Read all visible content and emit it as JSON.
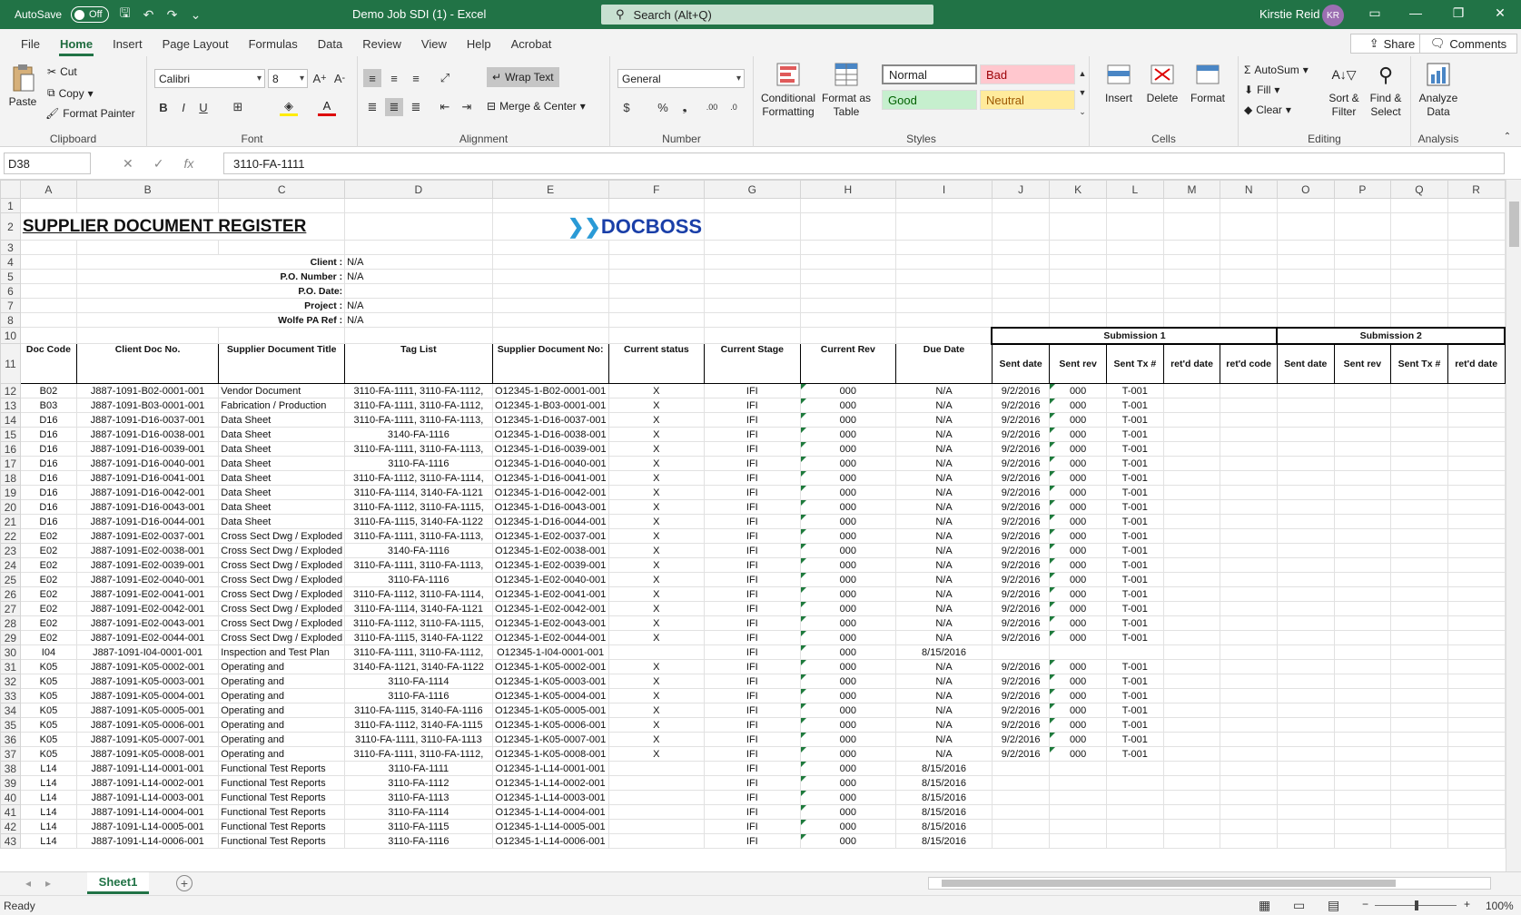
{
  "titlebar": {
    "autosave_label": "AutoSave",
    "autosave_state": "Off",
    "doc_title": "Demo Job SDI (1)  -  Excel",
    "search_placeholder": "Search (Alt+Q)",
    "user_name": "Kirstie Reid",
    "user_initials": "KR"
  },
  "menu": {
    "tabs": [
      "File",
      "Home",
      "Insert",
      "Page Layout",
      "Formulas",
      "Data",
      "Review",
      "View",
      "Help",
      "Acrobat"
    ],
    "share": "Share",
    "comments": "Comments"
  },
  "ribbon": {
    "clipboard": {
      "paste": "Paste",
      "cut": "Cut",
      "copy": "Copy",
      "format_painter": "Format Painter",
      "label": "Clipboard"
    },
    "font": {
      "name": "Calibri",
      "size": "8",
      "label": "Font"
    },
    "alignment": {
      "wrap": "Wrap Text",
      "merge": "Merge & Center",
      "label": "Alignment"
    },
    "number": {
      "format": "General",
      "label": "Number"
    },
    "styles": {
      "conditional": "Conditional",
      "conditional2": "Formatting",
      "format_as": "Format as",
      "format_as2": "Table",
      "normal": "Normal",
      "bad": "Bad",
      "good": "Good",
      "neutral": "Neutral",
      "label": "Styles"
    },
    "cells": {
      "insert": "Insert",
      "delete": "Delete",
      "format": "Format",
      "label": "Cells"
    },
    "editing": {
      "autosum": "AutoSum",
      "fill": "Fill",
      "clear": "Clear",
      "sort": "Sort &",
      "sort2": "Filter",
      "find": "Find &",
      "find2": "Select",
      "label": "Editing"
    },
    "analysis": {
      "analyze": "Analyze",
      "analyze2": "Data",
      "label": "Analysis"
    }
  },
  "formula": {
    "cell_ref": "D38",
    "content": "3110-FA-1111"
  },
  "columns": [
    "A",
    "B",
    "C",
    "D",
    "E",
    "F",
    "G",
    "H",
    "I",
    "J",
    "K",
    "L",
    "M",
    "N",
    "O",
    "P",
    "Q",
    "R"
  ],
  "sheet": {
    "title": "SUPPLIER DOCUMENT REGISTER",
    "logo": "DOCBOSS",
    "meta": [
      {
        "row": "4",
        "label": "Client :",
        "value": "N/A"
      },
      {
        "row": "5",
        "label": "P.O. Number :",
        "value": "N/A"
      },
      {
        "row": "6",
        "label": "P.O. Date:",
        "value": ""
      },
      {
        "row": "7",
        "label": "Project :",
        "value": "N/A"
      },
      {
        "row": "8",
        "label": "Wolfe PA Ref :",
        "value": "N/A"
      }
    ],
    "submission1": "Submission 1",
    "submission2": "Submission 2",
    "headers": [
      "Doc Code",
      "Client Doc No.",
      "Supplier Document Title",
      "Tag List",
      "Supplier Document No:",
      "Current status",
      "Current Stage",
      "Current Rev",
      "Due Date",
      "Sent date",
      "Sent rev",
      "Sent Tx #",
      "ret'd date",
      "ret'd code",
      "Sent date",
      "Sent rev",
      "Sent Tx #",
      "ret'd date"
    ],
    "rows": [
      [
        "12",
        "B02",
        "J887-1091-B02-0001-001",
        "Vendor Document",
        "3110-FA-1111, 3110-FA-1112,",
        "O12345-1-B02-0001-001",
        "X",
        "IFI",
        "000",
        "N/A",
        "9/2/2016",
        "000",
        "T-001"
      ],
      [
        "13",
        "B03",
        "J887-1091-B03-0001-001",
        "Fabrication / Production",
        "3110-FA-1111, 3110-FA-1112,",
        "O12345-1-B03-0001-001",
        "X",
        "IFI",
        "000",
        "N/A",
        "9/2/2016",
        "000",
        "T-001"
      ],
      [
        "14",
        "D16",
        "J887-1091-D16-0037-001",
        "Data Sheet",
        "3110-FA-1111, 3110-FA-1113,",
        "O12345-1-D16-0037-001",
        "X",
        "IFI",
        "000",
        "N/A",
        "9/2/2016",
        "000",
        "T-001"
      ],
      [
        "15",
        "D16",
        "J887-1091-D16-0038-001",
        "Data Sheet",
        "3140-FA-1116",
        "O12345-1-D16-0038-001",
        "X",
        "IFI",
        "000",
        "N/A",
        "9/2/2016",
        "000",
        "T-001"
      ],
      [
        "16",
        "D16",
        "J887-1091-D16-0039-001",
        "Data Sheet",
        "3110-FA-1111, 3110-FA-1113,",
        "O12345-1-D16-0039-001",
        "X",
        "IFI",
        "000",
        "N/A",
        "9/2/2016",
        "000",
        "T-001"
      ],
      [
        "17",
        "D16",
        "J887-1091-D16-0040-001",
        "Data Sheet",
        "3110-FA-1116",
        "O12345-1-D16-0040-001",
        "X",
        "IFI",
        "000",
        "N/A",
        "9/2/2016",
        "000",
        "T-001"
      ],
      [
        "18",
        "D16",
        "J887-1091-D16-0041-001",
        "Data Sheet",
        "3110-FA-1112, 3110-FA-1114,",
        "O12345-1-D16-0041-001",
        "X",
        "IFI",
        "000",
        "N/A",
        "9/2/2016",
        "000",
        "T-001"
      ],
      [
        "19",
        "D16",
        "J887-1091-D16-0042-001",
        "Data Sheet",
        "3110-FA-1114, 3140-FA-1121",
        "O12345-1-D16-0042-001",
        "X",
        "IFI",
        "000",
        "N/A",
        "9/2/2016",
        "000",
        "T-001"
      ],
      [
        "20",
        "D16",
        "J887-1091-D16-0043-001",
        "Data Sheet",
        "3110-FA-1112, 3110-FA-1115,",
        "O12345-1-D16-0043-001",
        "X",
        "IFI",
        "000",
        "N/A",
        "9/2/2016",
        "000",
        "T-001"
      ],
      [
        "21",
        "D16",
        "J887-1091-D16-0044-001",
        "Data Sheet",
        "3110-FA-1115, 3140-FA-1122",
        "O12345-1-D16-0044-001",
        "X",
        "IFI",
        "000",
        "N/A",
        "9/2/2016",
        "000",
        "T-001"
      ],
      [
        "22",
        "E02",
        "J887-1091-E02-0037-001",
        "Cross Sect Dwg / Exploded",
        "3110-FA-1111, 3110-FA-1113,",
        "O12345-1-E02-0037-001",
        "X",
        "IFI",
        "000",
        "N/A",
        "9/2/2016",
        "000",
        "T-001"
      ],
      [
        "23",
        "E02",
        "J887-1091-E02-0038-001",
        "Cross Sect Dwg / Exploded",
        "3140-FA-1116",
        "O12345-1-E02-0038-001",
        "X",
        "IFI",
        "000",
        "N/A",
        "9/2/2016",
        "000",
        "T-001"
      ],
      [
        "24",
        "E02",
        "J887-1091-E02-0039-001",
        "Cross Sect Dwg / Exploded",
        "3110-FA-1111, 3110-FA-1113,",
        "O12345-1-E02-0039-001",
        "X",
        "IFI",
        "000",
        "N/A",
        "9/2/2016",
        "000",
        "T-001"
      ],
      [
        "25",
        "E02",
        "J887-1091-E02-0040-001",
        "Cross Sect Dwg / Exploded",
        "3110-FA-1116",
        "O12345-1-E02-0040-001",
        "X",
        "IFI",
        "000",
        "N/A",
        "9/2/2016",
        "000",
        "T-001"
      ],
      [
        "26",
        "E02",
        "J887-1091-E02-0041-001",
        "Cross Sect Dwg / Exploded",
        "3110-FA-1112, 3110-FA-1114,",
        "O12345-1-E02-0041-001",
        "X",
        "IFI",
        "000",
        "N/A",
        "9/2/2016",
        "000",
        "T-001"
      ],
      [
        "27",
        "E02",
        "J887-1091-E02-0042-001",
        "Cross Sect Dwg / Exploded",
        "3110-FA-1114, 3140-FA-1121",
        "O12345-1-E02-0042-001",
        "X",
        "IFI",
        "000",
        "N/A",
        "9/2/2016",
        "000",
        "T-001"
      ],
      [
        "28",
        "E02",
        "J887-1091-E02-0043-001",
        "Cross Sect Dwg / Exploded",
        "3110-FA-1112, 3110-FA-1115,",
        "O12345-1-E02-0043-001",
        "X",
        "IFI",
        "000",
        "N/A",
        "9/2/2016",
        "000",
        "T-001"
      ],
      [
        "29",
        "E02",
        "J887-1091-E02-0044-001",
        "Cross Sect Dwg / Exploded",
        "3110-FA-1115, 3140-FA-1122",
        "O12345-1-E02-0044-001",
        "X",
        "IFI",
        "000",
        "N/A",
        "9/2/2016",
        "000",
        "T-001"
      ],
      [
        "30",
        "I04",
        "J887-1091-I04-0001-001",
        "Inspection and Test Plan",
        "3110-FA-1111, 3110-FA-1112,",
        "O12345-1-I04-0001-001",
        "",
        "IFI",
        "000",
        "8/15/2016",
        "",
        "",
        ""
      ],
      [
        "31",
        "K05",
        "J887-1091-K05-0002-001",
        "Operating and",
        "3140-FA-1121, 3140-FA-1122",
        "O12345-1-K05-0002-001",
        "X",
        "IFI",
        "000",
        "N/A",
        "9/2/2016",
        "000",
        "T-001"
      ],
      [
        "32",
        "K05",
        "J887-1091-K05-0003-001",
        "Operating and",
        "3110-FA-1114",
        "O12345-1-K05-0003-001",
        "X",
        "IFI",
        "000",
        "N/A",
        "9/2/2016",
        "000",
        "T-001"
      ],
      [
        "33",
        "K05",
        "J887-1091-K05-0004-001",
        "Operating and",
        "3110-FA-1116",
        "O12345-1-K05-0004-001",
        "X",
        "IFI",
        "000",
        "N/A",
        "9/2/2016",
        "000",
        "T-001"
      ],
      [
        "34",
        "K05",
        "J887-1091-K05-0005-001",
        "Operating and",
        "3110-FA-1115, 3140-FA-1116",
        "O12345-1-K05-0005-001",
        "X",
        "IFI",
        "000",
        "N/A",
        "9/2/2016",
        "000",
        "T-001"
      ],
      [
        "35",
        "K05",
        "J887-1091-K05-0006-001",
        "Operating and",
        "3110-FA-1112, 3140-FA-1115",
        "O12345-1-K05-0006-001",
        "X",
        "IFI",
        "000",
        "N/A",
        "9/2/2016",
        "000",
        "T-001"
      ],
      [
        "36",
        "K05",
        "J887-1091-K05-0007-001",
        "Operating and",
        "3110-FA-1111, 3110-FA-1113",
        "O12345-1-K05-0007-001",
        "X",
        "IFI",
        "000",
        "N/A",
        "9/2/2016",
        "000",
        "T-001"
      ],
      [
        "37",
        "K05",
        "J887-1091-K05-0008-001",
        "Operating and",
        "3110-FA-1111, 3110-FA-1112,",
        "O12345-1-K05-0008-001",
        "X",
        "IFI",
        "000",
        "N/A",
        "9/2/2016",
        "000",
        "T-001"
      ],
      [
        "38",
        "L14",
        "J887-1091-L14-0001-001",
        "Functional Test Reports",
        "3110-FA-1111",
        "O12345-1-L14-0001-001",
        "",
        "IFI",
        "000",
        "8/15/2016",
        "",
        "",
        ""
      ],
      [
        "39",
        "L14",
        "J887-1091-L14-0002-001",
        "Functional Test Reports",
        "3110-FA-1112",
        "O12345-1-L14-0002-001",
        "",
        "IFI",
        "000",
        "8/15/2016",
        "",
        "",
        ""
      ],
      [
        "40",
        "L14",
        "J887-1091-L14-0003-001",
        "Functional Test Reports",
        "3110-FA-1113",
        "O12345-1-L14-0003-001",
        "",
        "IFI",
        "000",
        "8/15/2016",
        "",
        "",
        ""
      ],
      [
        "41",
        "L14",
        "J887-1091-L14-0004-001",
        "Functional Test Reports",
        "3110-FA-1114",
        "O12345-1-L14-0004-001",
        "",
        "IFI",
        "000",
        "8/15/2016",
        "",
        "",
        ""
      ],
      [
        "42",
        "L14",
        "J887-1091-L14-0005-001",
        "Functional Test Reports",
        "3110-FA-1115",
        "O12345-1-L14-0005-001",
        "",
        "IFI",
        "000",
        "8/15/2016",
        "",
        "",
        ""
      ],
      [
        "43",
        "L14",
        "J887-1091-L14-0006-001",
        "Functional Test Reports",
        "3110-FA-1116",
        "O12345-1-L14-0006-001",
        "",
        "IFI",
        "000",
        "8/15/2016",
        "",
        "",
        ""
      ]
    ]
  },
  "sheet_tab": "Sheet1",
  "status": {
    "ready": "Ready",
    "zoom": "100%"
  }
}
